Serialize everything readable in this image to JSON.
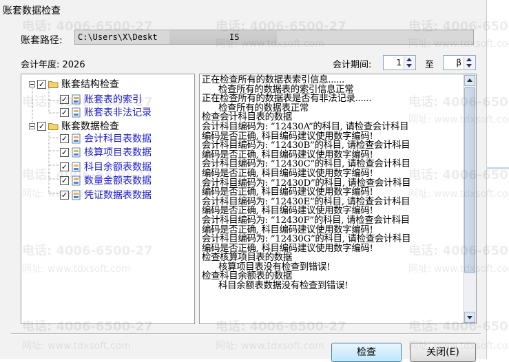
{
  "window": {
    "title": "账套数据检查"
  },
  "path": {
    "label": "账套路径:",
    "value_left": "C:\\Users\\X\\Deskt",
    "value_right": "IS"
  },
  "year": {
    "label": "会计年度: 2026"
  },
  "period": {
    "label": "会计期间:",
    "from": "1",
    "to_label": "至",
    "to": "β"
  },
  "tree": {
    "groups": [
      {
        "label": "账套结构检查",
        "checked": true,
        "children": [
          {
            "label": "账套表的索引",
            "checked": true
          },
          {
            "label": "账套表非法记录",
            "checked": true
          }
        ]
      },
      {
        "label": "账套数据检查",
        "checked": true,
        "children": [
          {
            "label": "会计科目表数据",
            "checked": true
          },
          {
            "label": "核算项目表数据",
            "checked": true
          },
          {
            "label": "科目余额表数据",
            "checked": true
          },
          {
            "label": "数量金额表数据",
            "checked": true
          },
          {
            "label": "凭证数据表数据",
            "checked": true
          }
        ]
      }
    ]
  },
  "log": {
    "lines": [
      {
        "text": "正在检查所有的数据表索引信息......",
        "indent": false
      },
      {
        "text": "检查所有的数据表的索引信息正常",
        "indent": true
      },
      {
        "text": "正在检查所有的数据表是否有非法记录......",
        "indent": false
      },
      {
        "text": "检查所有的数据表正常",
        "indent": true
      },
      {
        "text": "检查会计科目表的数据",
        "indent": false
      },
      {
        "text": "会计科目编码为: “12430A”的科目, 请检查会计科目",
        "indent": false
      },
      {
        "text": "编码是否正确, 科目编码建议使用数字编码!",
        "indent": false
      },
      {
        "text": "会计科目编码为: “12430B”的科目, 请检查会计科目",
        "indent": false
      },
      {
        "text": "编码是否正确, 科目编码建议使用数字编码!",
        "indent": false
      },
      {
        "text": "会计科目编码为: “12430C”的科目, 请检查会计科目",
        "indent": false
      },
      {
        "text": "编码是否正确, 科目编码建议使用数字编码!",
        "indent": false
      },
      {
        "text": "会计科目编码为: “12430D”的科目, 请检查会计科目",
        "indent": false
      },
      {
        "text": "编码是否正确, 科目编码建议使用数字编码!",
        "indent": false
      },
      {
        "text": "会计科目编码为: “12430E”的科目, 请检查会计科目",
        "indent": false
      },
      {
        "text": "编码是否正确, 科目编码建议使用数字编码!",
        "indent": false
      },
      {
        "text": "会计科目编码为: “12430F”的科目, 请检查会计科目",
        "indent": false
      },
      {
        "text": "编码是否正确, 科目编码建议使用数字编码!",
        "indent": false
      },
      {
        "text": "会计科目编码为: “12430G”的科目, 请检查会计科目",
        "indent": false
      },
      {
        "text": "编码是否正确, 科目编码建议使用数字编码!",
        "indent": false
      },
      {
        "text": "检查核算项目表的数据",
        "indent": false
      },
      {
        "text": "核算项目表没有检查到错误!",
        "indent": true
      },
      {
        "text": "检查科目余额表的数据",
        "indent": false
      },
      {
        "text": "科目余额表数据没有检查到错误!",
        "indent": true
      }
    ]
  },
  "buttons": {
    "check": "检查",
    "close": "关闭(E)"
  },
  "watermark": {
    "phone": "电话: 4006-6500-27",
    "site": "网址: www.tdxsoft.com"
  },
  "colors": {
    "tree_child_text": "#1b1bd6",
    "primary_button": "#bee6fd"
  }
}
